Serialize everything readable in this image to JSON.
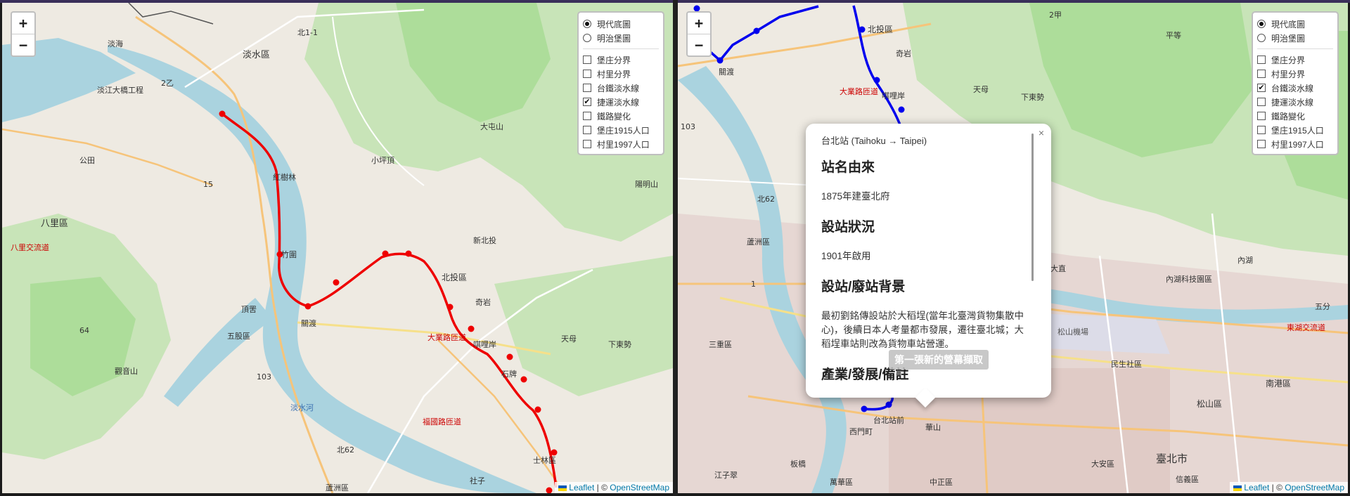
{
  "attribution": {
    "leaflet": "Leaflet",
    "sep": "| ©",
    "osm": "OpenStreetMap"
  },
  "layer_control": {
    "base": [
      {
        "label": "現代底圖",
        "checked": true
      },
      {
        "label": "明治堡圖",
        "checked": false
      }
    ],
    "left_overlays": [
      {
        "label": "堡庄分界",
        "checked": false
      },
      {
        "label": "村里分界",
        "checked": false
      },
      {
        "label": "台鐵淡水線",
        "checked": false
      },
      {
        "label": "捷運淡水線",
        "checked": true
      },
      {
        "label": "鐵路變化",
        "checked": false
      },
      {
        "label": "堡庄1915人口",
        "checked": false
      },
      {
        "label": "村里1997人口",
        "checked": false
      }
    ],
    "right_overlays": [
      {
        "label": "堡庄分界",
        "checked": false
      },
      {
        "label": "村里分界",
        "checked": false
      },
      {
        "label": "台鐵淡水線",
        "checked": true
      },
      {
        "label": "捷運淡水線",
        "checked": false
      },
      {
        "label": "鐵路變化",
        "checked": false
      },
      {
        "label": "堡庄1915人口",
        "checked": false
      },
      {
        "label": "村里1997人口",
        "checked": false
      }
    ]
  },
  "zoom": {
    "in": "+",
    "out": "−"
  },
  "popup": {
    "station": "台北站 (Taihoku → Taipei)",
    "close": "×",
    "h1": "站名由來",
    "p1": "1875年建臺北府",
    "h2": "設站狀況",
    "p2": "1901年啟用",
    "h3": "設站/廢站背景",
    "p3": "最初劉銘傳設站於大稻埕(當年北臺灣貨物集散中心)，後續日本人考量都市發展，遷往臺北城；大稻埕車站則改為貨物車站營運。",
    "h4": "產業/發展/備註",
    "overlay_text": "第一張新的營幕擷取"
  },
  "left_labels": {
    "a1": "淡海",
    "a2": "淡水區",
    "a3": "淡江大橋工程",
    "a4": "八里區",
    "a5": "八里交流道",
    "a6": "公田",
    "a7": "紅樹林",
    "a8": "竹圍",
    "a9": "關渡",
    "a10": "北投區",
    "a11": "奇岩",
    "a12": "唭哩岸",
    "a13": "石牌",
    "a14": "天母",
    "a15": "陽明山",
    "a16": "新北投",
    "a17": "小坪頂",
    "a18": "大屯山",
    "a19": "大業路匝道",
    "a20": "福國路匝道",
    "a21": "士林區",
    "a22": "蘆洲區",
    "a23": "社子",
    "a24": "頂罟",
    "a25": "北1-1",
    "a26": "北62",
    "a27": "下東勢",
    "a28": "五股區",
    "a29": "觀音山",
    "a30": "淡水河",
    "a31": "2乙",
    "a32": "103",
    "a33": "64",
    "a34": "15"
  },
  "right_labels": {
    "b1": "北投區",
    "b2": "關渡",
    "b3": "奇岩",
    "b4": "天母",
    "b5": "唭哩岸",
    "b6": "下東勢",
    "b7": "平等",
    "b8": "大直",
    "b9": "內湖",
    "b10": "內湖科技園區",
    "b11": "五分",
    "b12": "民生社區",
    "b13": "南港區",
    "b14": "松山區",
    "b15": "臺北市",
    "b16": "信義區",
    "b17": "大安區",
    "b18": "中正區",
    "b19": "萬華區",
    "b20": "台北站前",
    "b21": "西門町",
    "b22": "華山",
    "b23": "松山機場",
    "b24": "蘆洲區",
    "b25": "三重區",
    "b26": "江子翠",
    "b27": "板橋",
    "b28": "東湖交流道",
    "b29": "大業路匝道",
    "b30": "北62",
    "b31": "103",
    "b32": "2甲",
    "b33": "1"
  }
}
